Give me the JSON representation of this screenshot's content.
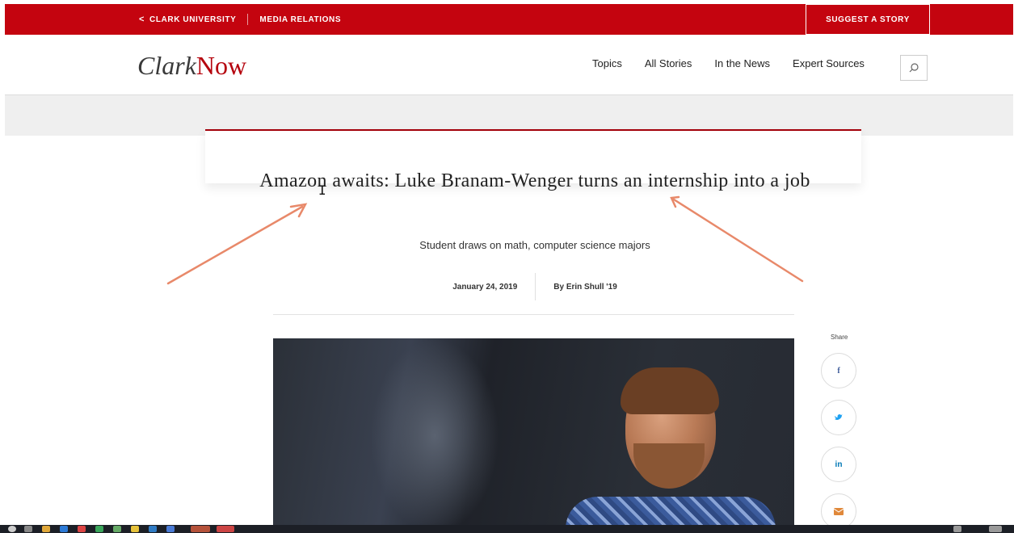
{
  "topbar": {
    "back_chevron": "<",
    "university": "CLARK UNIVERSITY",
    "media": "MEDIA RELATIONS",
    "suggest": "SUGGEST A STORY"
  },
  "header": {
    "logo_clark": "Clark",
    "logo_now": "Now",
    "nav": [
      "Topics",
      "All Stories",
      "In the News",
      "Expert Sources"
    ],
    "search_icon": "search-icon"
  },
  "article": {
    "headline": "Amazon awaits: Luke Branam-Wenger turns an internship into a job",
    "deck": "Student draws on math, computer science majors",
    "date": "January 24, 2019",
    "byline": "By Erin Shull '19"
  },
  "share": {
    "label": "Share",
    "buttons": [
      {
        "name": "facebook",
        "glyph": "f",
        "color": "#3b5998"
      },
      {
        "name": "twitter",
        "glyph": "❧",
        "color": "#1da1f2"
      },
      {
        "name": "linkedin",
        "glyph": "in",
        "color": "#0077b5"
      },
      {
        "name": "email",
        "glyph": "✉",
        "color": "#e0883a"
      }
    ]
  },
  "colors": {
    "brand_red": "#c4040f",
    "arrow": "#e8896a"
  }
}
